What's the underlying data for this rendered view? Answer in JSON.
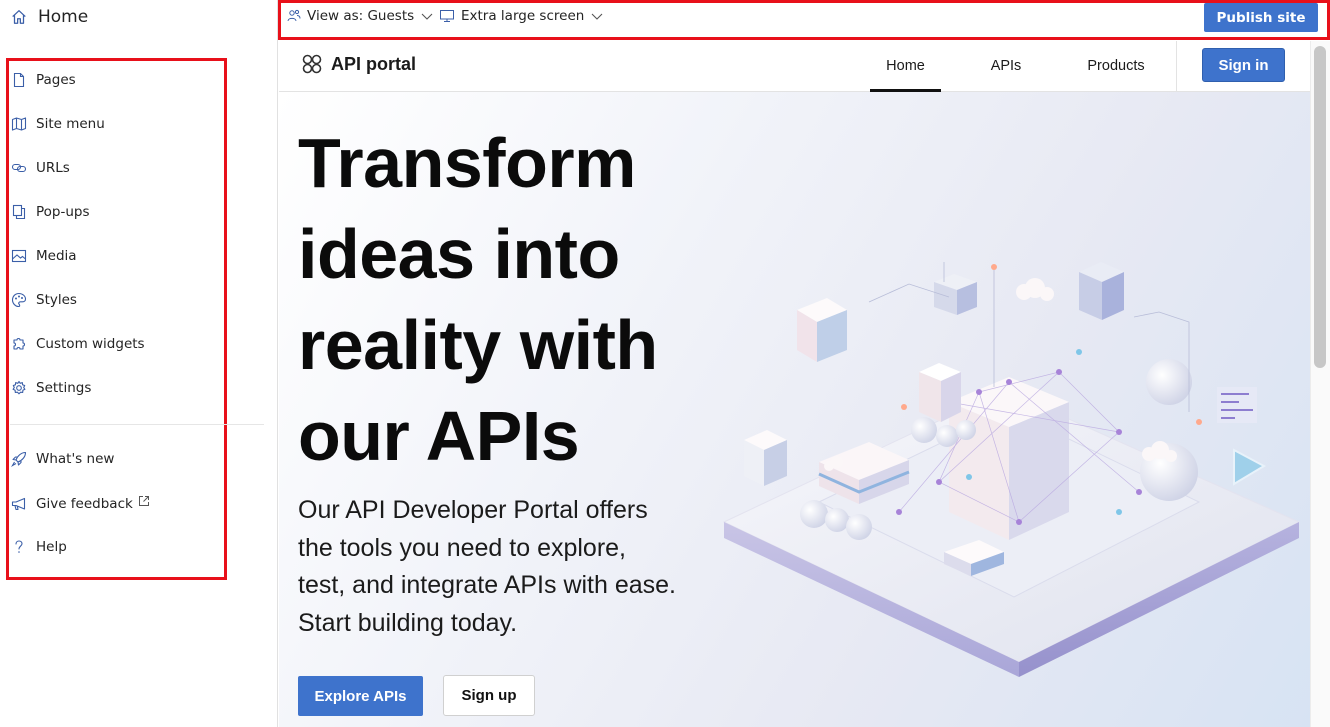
{
  "sidebar": {
    "home_label": "Home",
    "items": [
      {
        "label": "Pages",
        "icon": "page-icon"
      },
      {
        "label": "Site menu",
        "icon": "map-icon"
      },
      {
        "label": "URLs",
        "icon": "link-icon"
      },
      {
        "label": "Pop-ups",
        "icon": "popup-icon"
      },
      {
        "label": "Media",
        "icon": "image-icon"
      },
      {
        "label": "Styles",
        "icon": "palette-icon"
      },
      {
        "label": "Custom widgets",
        "icon": "puzzle-icon"
      },
      {
        "label": "Settings",
        "icon": "gear-icon"
      }
    ],
    "secondary": [
      {
        "label": "What's new",
        "icon": "rocket-icon"
      },
      {
        "label": "Give feedback",
        "icon": "megaphone-icon"
      },
      {
        "label": "Help",
        "icon": "question-icon"
      }
    ]
  },
  "toolbar": {
    "view_as": "View as: Guests",
    "screen": "Extra large screen",
    "publish_label": "Publish site"
  },
  "site": {
    "brand": "API portal",
    "nav": [
      "Home",
      "APIs",
      "Products"
    ],
    "signin_label": "Sign in",
    "hero_title": "Transform ideas into reality with our APIs",
    "hero_subtitle": "Our API Developer Portal offers the tools you need to explore, test, and integrate APIs with ease. Start building today.",
    "explore_label": "Explore APIs",
    "signup_label": "Sign up"
  },
  "colors": {
    "accent": "#3e73cc",
    "highlight_border": "#e8101a",
    "icon": "#3b5fa8"
  }
}
